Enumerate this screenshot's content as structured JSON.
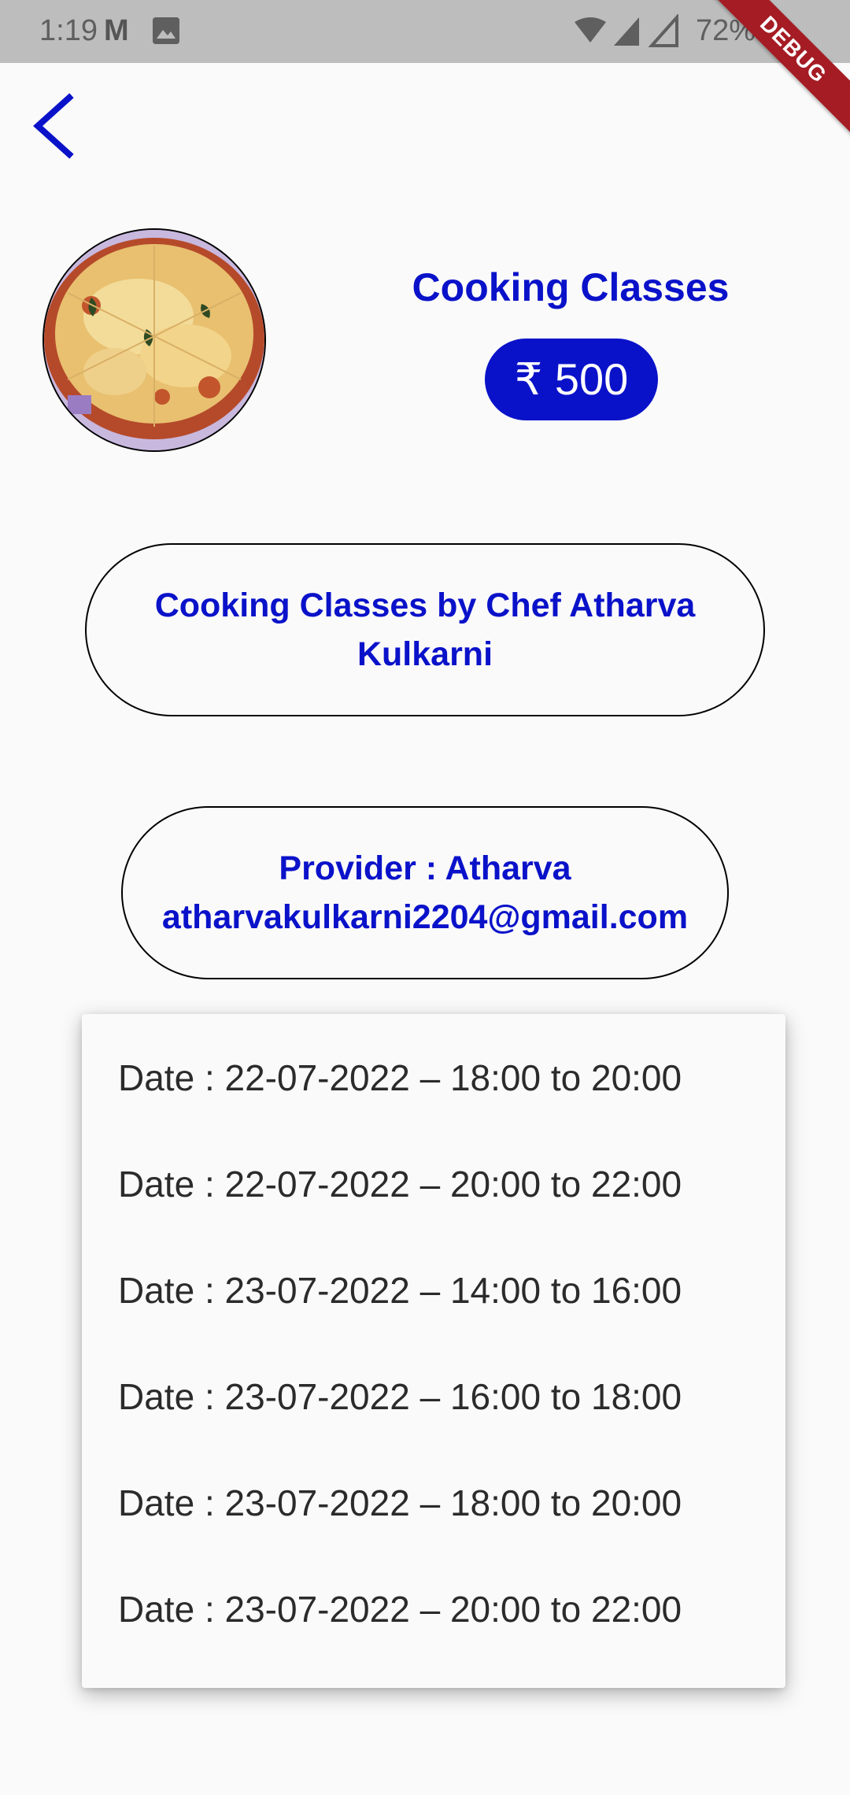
{
  "status_bar": {
    "time": "1:19",
    "notification_m": "M",
    "battery": "72%"
  },
  "debug_banner": "DEBUG",
  "header": {
    "back_icon": "chevron-left-icon"
  },
  "course": {
    "title": "Cooking Classes",
    "price": "₹ 500",
    "description": "Cooking Classes by Chef Atharva Kulkarni",
    "provider_line": "Provider : Atharva",
    "provider_email": "atharvakulkarni2204@gmail.com"
  },
  "slots_menu": {
    "items": [
      "Date : 22-07-2022 – 18:00 to 20:00",
      "Date : 22-07-2022 – 20:00 to 22:00",
      "Date : 23-07-2022 – 14:00 to 16:00",
      "Date : 23-07-2022 – 16:00 to 18:00",
      "Date : 23-07-2022 – 18:00 to 20:00",
      "Date : 23-07-2022 – 20:00 to 22:00"
    ]
  },
  "colors": {
    "accent": "#0a12c9",
    "background": "#fafafa",
    "status_bar": "#bdbdbd",
    "debug_ribbon": "#a51c24"
  }
}
